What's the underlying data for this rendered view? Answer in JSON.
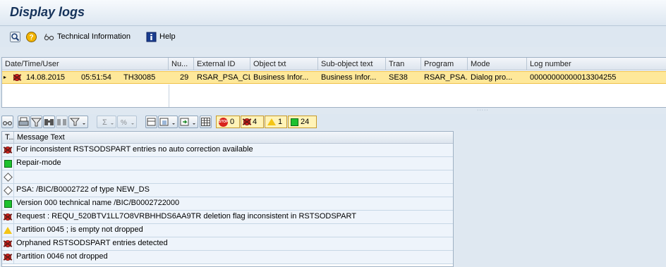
{
  "window": {
    "title": "Display logs"
  },
  "toolbar": {
    "tech_info_label": "Technical Information",
    "help_label": "Help"
  },
  "log_grid": {
    "columns": [
      "Date/Time/User",
      "Nu...",
      "External ID",
      "Object txt",
      "Sub-object text",
      "Tran",
      "Program",
      "Mode",
      "Log number"
    ],
    "row": {
      "date": "14.08.2015",
      "time": "05:51:54",
      "user": "TH30085",
      "number": "29",
      "external_id": "RSAR_PSA_CL...",
      "object_txt": "Business Infor...",
      "subobject_txt": "Business Infor...",
      "tran": "SE38",
      "program": "RSAR_PSA...",
      "mode": "Dialog pro...",
      "log_number": "00000000000013304255"
    }
  },
  "counts": {
    "stop": "0",
    "error": "4",
    "warning": "1",
    "success": "24"
  },
  "messages": {
    "col_type": "T...",
    "col_text": "Message Text",
    "items": [
      {
        "type": "error",
        "text": "For inconsistent RSTSODSPART entries no auto correction available"
      },
      {
        "type": "success",
        "text": "Repair-mode"
      },
      {
        "type": "info",
        "text": ""
      },
      {
        "type": "info",
        "text": "PSA: /BIC/B0002722 of type NEW_DS"
      },
      {
        "type": "success",
        "text": "Version 000 technical name /BIC/B0002722000"
      },
      {
        "type": "error",
        "text": "Request : REQU_520BTV1LL7O8VRBHHDS6AA9TR deletion flag inconsistent in RSTSODSPART"
      },
      {
        "type": "warning",
        "text": "Partition 0045 ; is empty not dropped"
      },
      {
        "type": "error",
        "text": "Orphaned RSTSODSPART entries detected"
      },
      {
        "type": "error",
        "text": "Partition 0046 not dropped"
      }
    ]
  },
  "colors": {
    "selected_row": "#fee89a",
    "error": "#e0251f",
    "success": "#1dc12d",
    "warning": "#f4c515"
  }
}
